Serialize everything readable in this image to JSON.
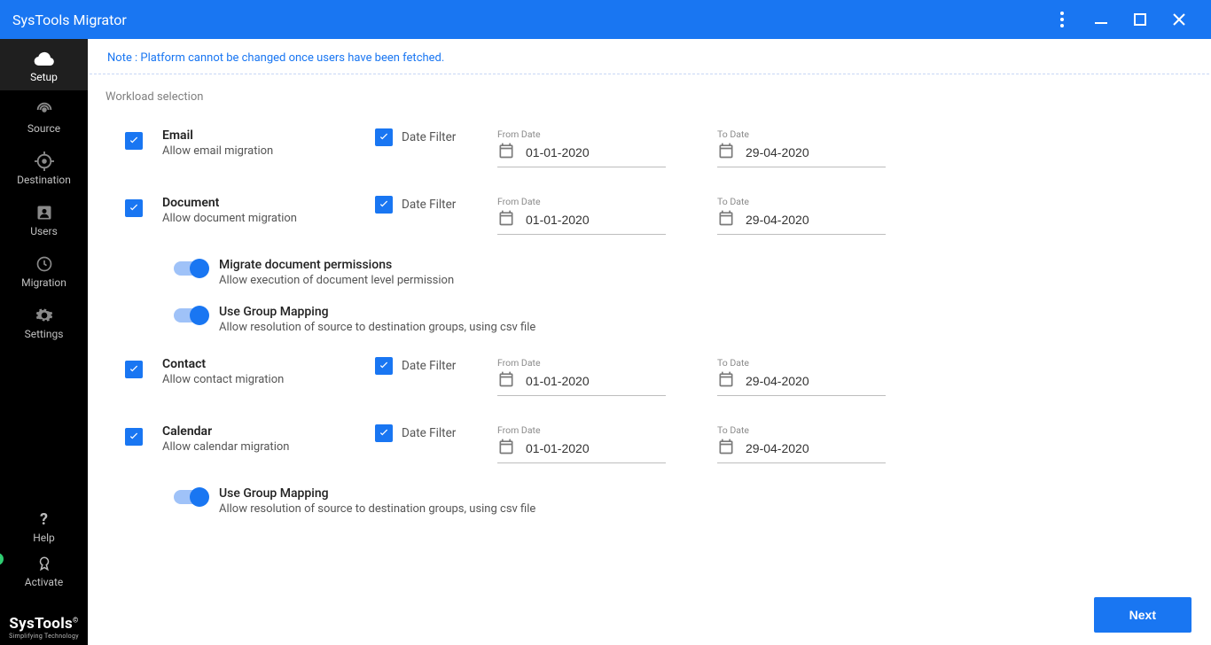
{
  "title": "SysTools Migrator",
  "sidebar": {
    "items": [
      {
        "label": "Setup"
      },
      {
        "label": "Source"
      },
      {
        "label": "Destination"
      },
      {
        "label": "Users"
      },
      {
        "label": "Migration"
      },
      {
        "label": "Settings"
      }
    ],
    "help": "Help",
    "activate": "Activate"
  },
  "brand": {
    "name": "SysTools",
    "tagline": "Simplifying Technology"
  },
  "note": "Note : Platform cannot be changed once users have been fetched.",
  "section": "Workload selection",
  "labels": {
    "dateFilter": "Date Filter",
    "fromDate": "From Date",
    "toDate": "To Date"
  },
  "workloads": {
    "email": {
      "title": "Email",
      "sub": "Allow email migration",
      "from": "01-01-2020",
      "to": "29-04-2020"
    },
    "document": {
      "title": "Document",
      "sub": "Allow document migration",
      "from": "01-01-2020",
      "to": "29-04-2020",
      "opts": {
        "perm": {
          "title": "Migrate document permissions",
          "sub": "Allow execution of document level permission"
        },
        "group": {
          "title": "Use Group Mapping",
          "sub": "Allow resolution of source to destination groups, using csv file"
        }
      }
    },
    "contact": {
      "title": "Contact",
      "sub": "Allow contact migration",
      "from": "01-01-2020",
      "to": "29-04-2020"
    },
    "calendar": {
      "title": "Calendar",
      "sub": "Allow calendar migration",
      "from": "01-01-2020",
      "to": "29-04-2020",
      "opts": {
        "group": {
          "title": "Use Group Mapping",
          "sub": "Allow resolution of source to destination groups, using csv file"
        }
      }
    }
  },
  "next": "Next"
}
